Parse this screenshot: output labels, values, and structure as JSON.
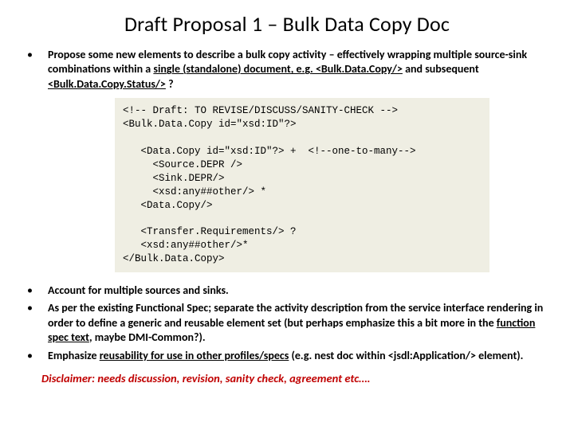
{
  "title": "Draft Proposal 1 – Bulk Data Copy Doc",
  "bullet1": {
    "pre": "Propose some new elements to describe a bulk copy activity – effectively wrapping multiple source-sink combinations within a ",
    "u1": "single (standalone) document, e.g. <Bulk.Data.Copy/>",
    "mid": " and subsequent ",
    "u2": "<Bulk.Data.Copy.Status/>",
    "post": " ?"
  },
  "code": "<!-- Draft: TO REVISE/DISCUSS/SANITY-CHECK -->\n<Bulk.Data.Copy id=\"xsd:ID\"?>\n\n   <Data.Copy id=\"xsd:ID\"?> +  <!--one-to-many-->\n     <Source.DEPR />\n     <Sink.DEPR/>\n     <xsd:any##other/> *\n   <Data.Copy/>\n\n   <Transfer.Requirements/> ?\n   <xsd:any##other/>*\n</Bulk.Data.Copy>",
  "bullet2": "Account for multiple sources and sinks.",
  "bullet3": {
    "pre": "As per the existing Functional Spec;  separate the activity description from the service interface rendering in order to define a generic and reusable element set (but perhaps emphasize this a bit more in the ",
    "u": "function spec text",
    "post": ", maybe DMI-Common?)."
  },
  "bullet4": {
    "pre": "Emphasize ",
    "u": "reusability for use in other profiles/specs",
    "post": " (e.g. nest doc within <jsdl:Application/> element)."
  },
  "disclaimer": "Disclaimer: needs discussion, revision, sanity check, agreement etc…."
}
